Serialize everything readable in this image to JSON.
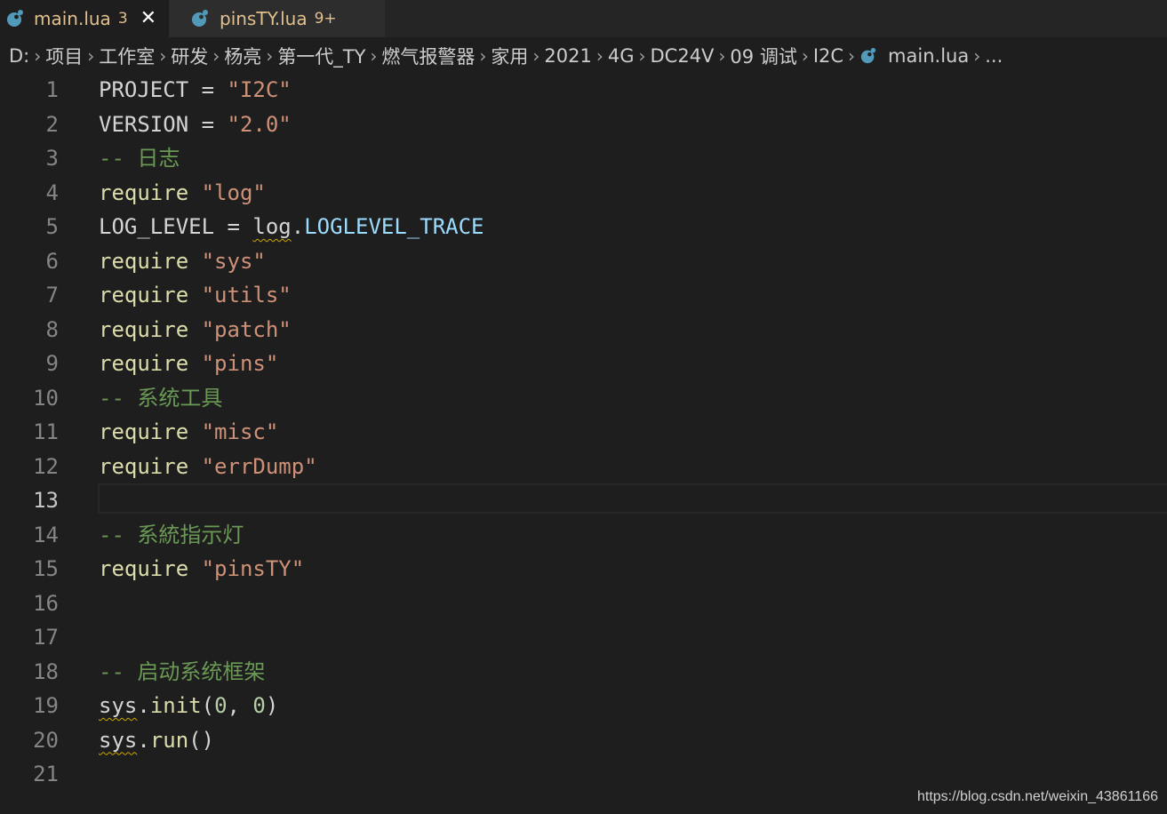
{
  "tabs": [
    {
      "label": "main.lua",
      "badge": "3",
      "close_glyph": "✕",
      "active": true,
      "icon": "lua-file-icon"
    },
    {
      "label": "pinsTY.lua",
      "badge": "9+",
      "active": false,
      "icon": "lua-file-icon"
    }
  ],
  "breadcrumb": {
    "items": [
      "D:",
      "项目",
      "工作室",
      "研发",
      "杨亮",
      "第一代_TY",
      "燃气报警器",
      "家用",
      "2021",
      "4G",
      "DC24V",
      "09 调试",
      "I2C"
    ],
    "file": "main.lua",
    "more": "...",
    "separator": "›"
  },
  "editor": {
    "current_line": 13,
    "lines": [
      {
        "num": "1",
        "tokens": [
          [
            "plain",
            "PROJECT = "
          ],
          [
            "str",
            "\"I2C\""
          ]
        ]
      },
      {
        "num": "2",
        "tokens": [
          [
            "plain",
            "VERSION = "
          ],
          [
            "str",
            "\"2.0\""
          ]
        ]
      },
      {
        "num": "3",
        "tokens": [
          [
            "comment",
            "-- 日志"
          ]
        ]
      },
      {
        "num": "4",
        "tokens": [
          [
            "fn",
            "require"
          ],
          [
            "plain",
            " "
          ],
          [
            "str",
            "\"log\""
          ]
        ]
      },
      {
        "num": "5",
        "tokens": [
          [
            "plain",
            "LOG_LEVEL = "
          ],
          [
            "sq",
            "log"
          ],
          [
            "plain",
            "."
          ],
          [
            "prop",
            "LOGLEVEL_TRACE"
          ]
        ]
      },
      {
        "num": "6",
        "tokens": [
          [
            "fn",
            "require"
          ],
          [
            "plain",
            " "
          ],
          [
            "str",
            "\"sys\""
          ]
        ]
      },
      {
        "num": "7",
        "tokens": [
          [
            "fn",
            "require"
          ],
          [
            "plain",
            " "
          ],
          [
            "str",
            "\"utils\""
          ]
        ]
      },
      {
        "num": "8",
        "tokens": [
          [
            "fn",
            "require"
          ],
          [
            "plain",
            " "
          ],
          [
            "str",
            "\"patch\""
          ]
        ]
      },
      {
        "num": "9",
        "tokens": [
          [
            "fn",
            "require"
          ],
          [
            "plain",
            " "
          ],
          [
            "str",
            "\"pins\""
          ]
        ]
      },
      {
        "num": "10",
        "tokens": [
          [
            "comment",
            "-- 系统工具"
          ]
        ]
      },
      {
        "num": "11",
        "tokens": [
          [
            "fn",
            "require"
          ],
          [
            "plain",
            " "
          ],
          [
            "str",
            "\"misc\""
          ]
        ]
      },
      {
        "num": "12",
        "tokens": [
          [
            "fn",
            "require"
          ],
          [
            "plain",
            " "
          ],
          [
            "str",
            "\"errDump\""
          ]
        ]
      },
      {
        "num": "13",
        "tokens": []
      },
      {
        "num": "14",
        "tokens": [
          [
            "comment",
            "-- 系統指示灯"
          ]
        ]
      },
      {
        "num": "15",
        "tokens": [
          [
            "fn",
            "require"
          ],
          [
            "plain",
            " "
          ],
          [
            "str",
            "\"pinsTY\""
          ]
        ]
      },
      {
        "num": "16",
        "tokens": []
      },
      {
        "num": "17",
        "tokens": []
      },
      {
        "num": "18",
        "tokens": [
          [
            "comment",
            "-- 启动系统框架"
          ]
        ]
      },
      {
        "num": "19",
        "tokens": [
          [
            "sq",
            "sys"
          ],
          [
            "plain",
            "."
          ],
          [
            "fn",
            "init"
          ],
          [
            "plain",
            "("
          ],
          [
            "num",
            "0"
          ],
          [
            "plain",
            ", "
          ],
          [
            "num",
            "0"
          ],
          [
            "plain",
            ")"
          ]
        ]
      },
      {
        "num": "20",
        "tokens": [
          [
            "sq",
            "sys"
          ],
          [
            "plain",
            "."
          ],
          [
            "fn",
            "run"
          ],
          [
            "plain",
            "()"
          ]
        ]
      },
      {
        "num": "21",
        "tokens": []
      }
    ]
  },
  "watermark": "https://blog.csdn.net/weixin_43861166",
  "colors": {
    "background": "#1e1e1e",
    "string": "#ce9178",
    "comment": "#6a9955",
    "function": "#dcdcaa",
    "property": "#9cdcfe",
    "number": "#b5cea8",
    "modified_tab": "#e2c08d",
    "lua_icon": "#519aba"
  }
}
